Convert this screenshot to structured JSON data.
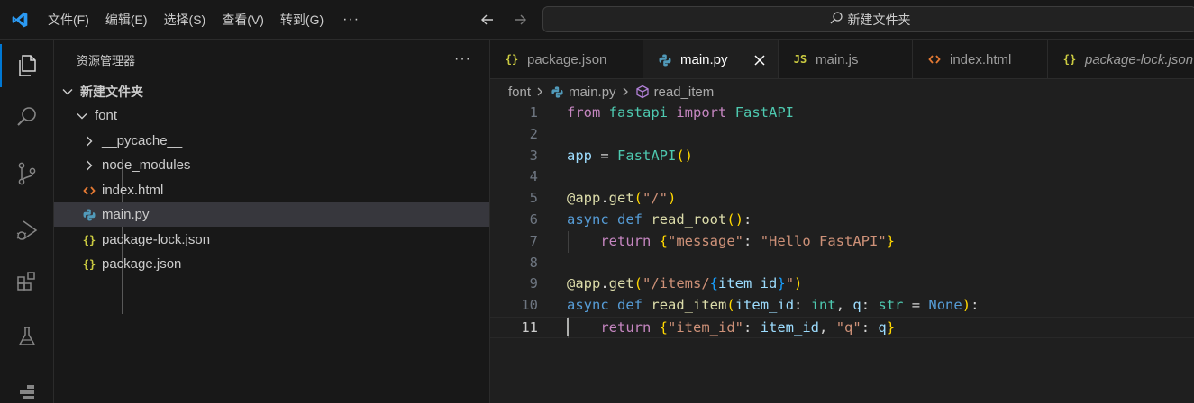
{
  "menu": [
    "文件(F)",
    "编辑(E)",
    "选择(S)",
    "查看(V)",
    "转到(G)"
  ],
  "menu_more": "···",
  "command_center": {
    "text": "新建文件夹"
  },
  "activity_bar": [
    {
      "icon": "explorer-icon",
      "active": true
    },
    {
      "icon": "search-icon",
      "active": false
    },
    {
      "icon": "source-control-icon",
      "active": false
    },
    {
      "icon": "run-debug-icon",
      "active": false
    },
    {
      "icon": "extensions-icon",
      "active": false
    },
    {
      "icon": "testing-icon",
      "active": false
    },
    {
      "icon": "remote-icon",
      "active": false
    }
  ],
  "sidebar": {
    "title": "资源管理器",
    "more": "···",
    "tree": [
      {
        "label": "新建文件夹",
        "type": "folder-root",
        "expanded": true,
        "depth": 0
      },
      {
        "label": "font",
        "type": "folder",
        "expanded": true,
        "depth": 1
      },
      {
        "label": "__pycache__",
        "type": "folder",
        "expanded": false,
        "depth": 2
      },
      {
        "label": "node_modules",
        "type": "folder",
        "expanded": false,
        "depth": 2
      },
      {
        "label": "index.html",
        "type": "html",
        "depth": 2
      },
      {
        "label": "main.py",
        "type": "python",
        "depth": 2,
        "selected": true
      },
      {
        "label": "package-lock.json",
        "type": "json",
        "depth": 2
      },
      {
        "label": "package.json",
        "type": "json",
        "depth": 2
      }
    ]
  },
  "tabs": [
    {
      "label": "package.json",
      "icon": "json",
      "icon_text": "{ }",
      "active": false,
      "italic": false
    },
    {
      "label": "main.py",
      "icon": "python",
      "icon_text": "",
      "active": true,
      "italic": false
    },
    {
      "label": "main.js",
      "icon": "js",
      "icon_text": "JS",
      "active": false,
      "italic": false
    },
    {
      "label": "index.html",
      "icon": "html",
      "icon_text": "<>",
      "active": false,
      "italic": false
    },
    {
      "label": "package-lock.json",
      "icon": "json",
      "icon_text": "{ }",
      "active": false,
      "italic": true
    }
  ],
  "breadcrumb": [
    "font",
    "main.py",
    "read_item"
  ],
  "code": {
    "current_line": 11,
    "lines": [
      {
        "n": "1",
        "tokens": [
          [
            "kw",
            "from"
          ],
          [
            "plain",
            " "
          ],
          [
            "cls",
            "fastapi"
          ],
          [
            "plain",
            " "
          ],
          [
            "kw",
            "import"
          ],
          [
            "plain",
            " "
          ],
          [
            "cls",
            "FastAPI"
          ]
        ]
      },
      {
        "n": "2",
        "tokens": []
      },
      {
        "n": "3",
        "tokens": [
          [
            "var",
            "app"
          ],
          [
            "op",
            " = "
          ],
          [
            "cls",
            "FastAPI"
          ],
          [
            "brk1",
            "()"
          ]
        ]
      },
      {
        "n": "4",
        "tokens": []
      },
      {
        "n": "5",
        "tokens": [
          [
            "fn",
            "@app"
          ],
          [
            "op",
            "."
          ],
          [
            "fn",
            "get"
          ],
          [
            "brk1",
            "("
          ],
          [
            "str",
            "\"/\""
          ],
          [
            "brk1",
            ")"
          ]
        ]
      },
      {
        "n": "6",
        "tokens": [
          [
            "kwb",
            "async"
          ],
          [
            "plain",
            " "
          ],
          [
            "kwb",
            "def"
          ],
          [
            "plain",
            " "
          ],
          [
            "fn",
            "read_root"
          ],
          [
            "brk1",
            "()"
          ],
          [
            "op",
            ":"
          ]
        ]
      },
      {
        "n": "7",
        "tokens": [
          [
            "plain",
            "    "
          ],
          [
            "kw",
            "return"
          ],
          [
            "plain",
            " "
          ],
          [
            "brk1",
            "{"
          ],
          [
            "str",
            "\"message\""
          ],
          [
            "op",
            ": "
          ],
          [
            "str",
            "\"Hello FastAPI\""
          ],
          [
            "brk1",
            "}"
          ]
        ]
      },
      {
        "n": "8",
        "tokens": []
      },
      {
        "n": "9",
        "tokens": [
          [
            "fn",
            "@app"
          ],
          [
            "op",
            "."
          ],
          [
            "fn",
            "get"
          ],
          [
            "brk1",
            "("
          ],
          [
            "str",
            "\"/items/"
          ],
          [
            "brk3",
            "{"
          ],
          [
            "var",
            "item_id"
          ],
          [
            "brk3",
            "}"
          ],
          [
            "str",
            "\""
          ],
          [
            "brk1",
            ")"
          ]
        ]
      },
      {
        "n": "10",
        "tokens": [
          [
            "kwb",
            "async"
          ],
          [
            "plain",
            " "
          ],
          [
            "kwb",
            "def"
          ],
          [
            "plain",
            " "
          ],
          [
            "fn",
            "read_item"
          ],
          [
            "brk1",
            "("
          ],
          [
            "var",
            "item_id"
          ],
          [
            "op",
            ": "
          ],
          [
            "cls",
            "int"
          ],
          [
            "op",
            ", "
          ],
          [
            "var",
            "q"
          ],
          [
            "op",
            ": "
          ],
          [
            "cls",
            "str"
          ],
          [
            "op",
            " = "
          ],
          [
            "kwb",
            "None"
          ],
          [
            "brk1",
            ")"
          ],
          [
            "op",
            ":"
          ]
        ]
      },
      {
        "n": "11",
        "tokens": [
          [
            "plain",
            "    "
          ],
          [
            "kw",
            "return"
          ],
          [
            "plain",
            " "
          ],
          [
            "brk1",
            "{"
          ],
          [
            "str",
            "\"item_id\""
          ],
          [
            "op",
            ": "
          ],
          [
            "var",
            "item_id"
          ],
          [
            "op",
            ", "
          ],
          [
            "str",
            "\"q\""
          ],
          [
            "op",
            ": "
          ],
          [
            "var",
            "q"
          ],
          [
            "brk1",
            "}"
          ]
        ]
      }
    ]
  },
  "colors": {
    "accent": "#0078d4",
    "json_icon": "#cbcb41",
    "python_icon": "#519aba",
    "html_icon": "#e37933",
    "js_icon": "#cbcb41",
    "symbol_icon": "#b180d7"
  }
}
